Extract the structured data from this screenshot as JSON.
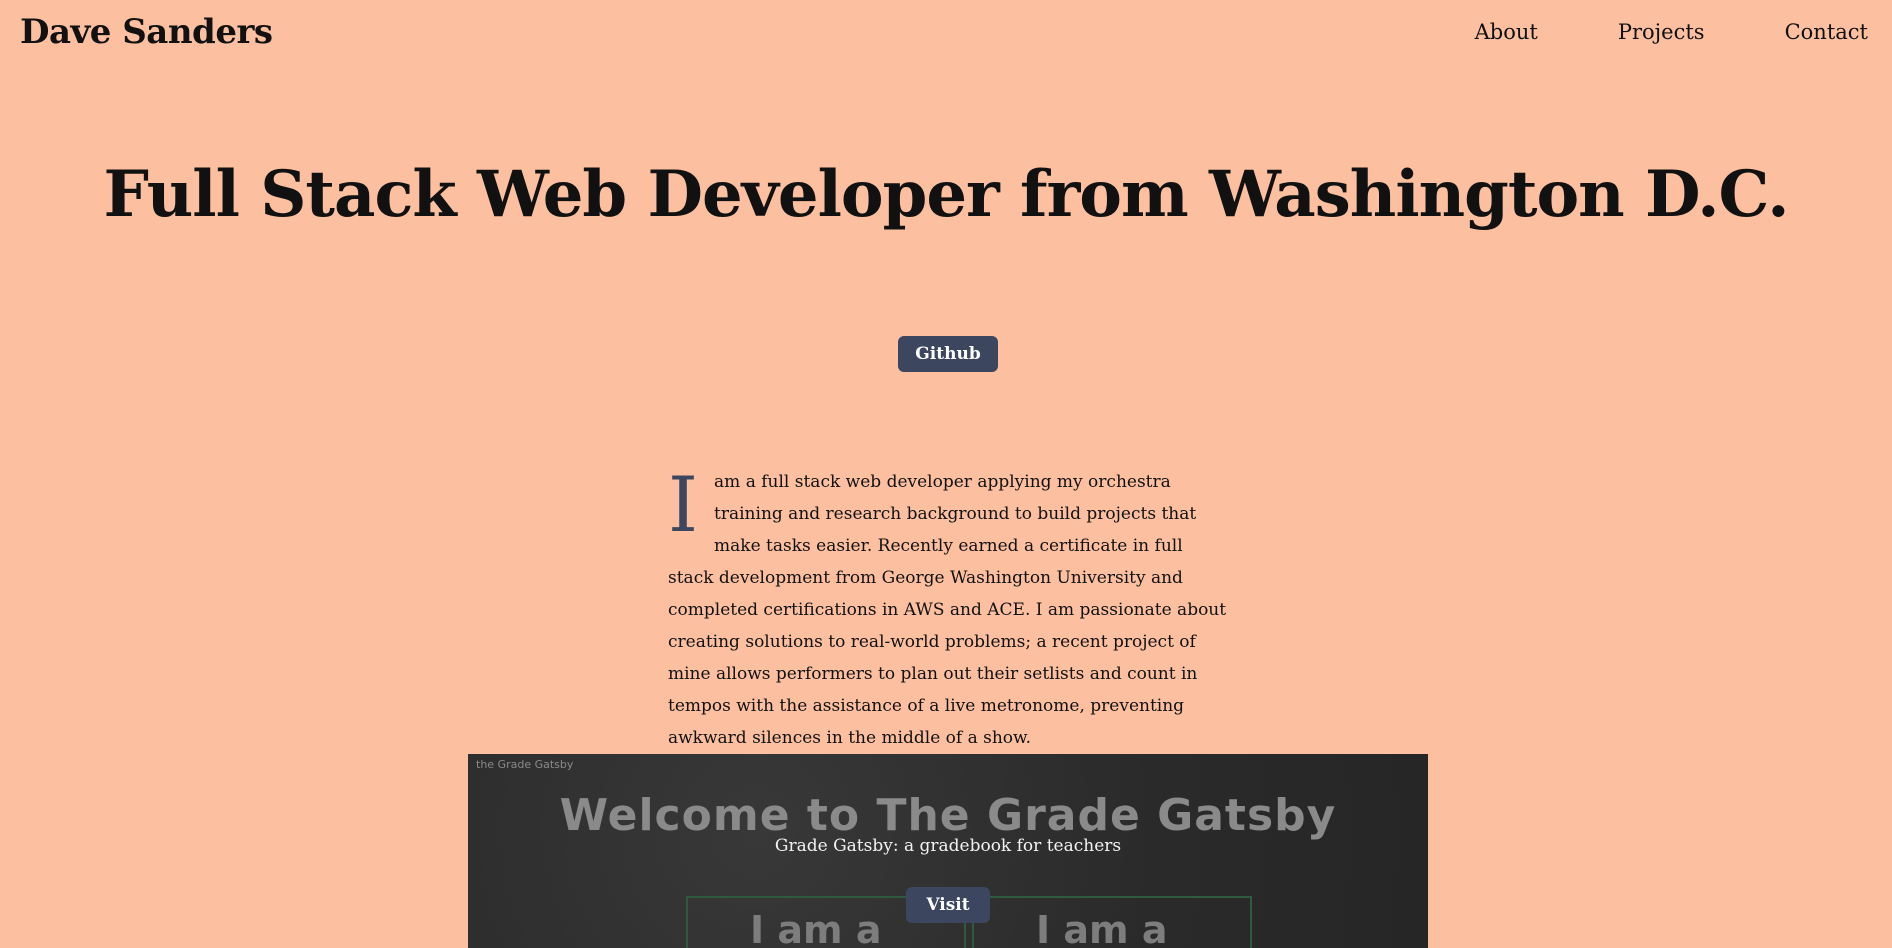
{
  "header": {
    "brand": "Dave Sanders",
    "nav": [
      "About",
      "Projects",
      "Contact"
    ]
  },
  "hero": {
    "title": "Full Stack Web Developer from Washington D.C.",
    "github_label": "Github"
  },
  "bio": {
    "dropcap": "I",
    "text": "am a full stack web developer applying my orchestra training and research background to build projects that make tasks easier. Recently earned a certificate in full stack development from George Washington University and completed certifications in AWS and ACE. I am passionate about creating solutions to real-world problems; a recent project of mine allows performers to plan out their setlists and count in tempos with the assistance of a live metronome, preventing awkward silences in the middle of a show."
  },
  "project": {
    "tag": "the Grade Gatsby",
    "screenshot_title": "Welcome to The Grade Gatsby",
    "caption": "Grade Gatsby: a gradebook for teachers",
    "visit_label": "Visit",
    "card_left": "I am a",
    "card_right": "I am a"
  },
  "colors": {
    "background": "#fcbfa0",
    "button": "#3c475f",
    "dropcap": "#3c475f"
  }
}
